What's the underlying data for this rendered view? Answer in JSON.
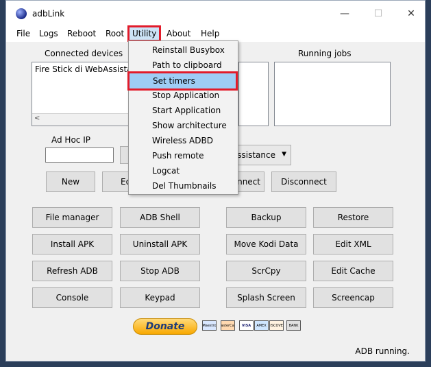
{
  "window": {
    "title": "adbLink",
    "min": "—",
    "max": "☐",
    "close": "✕"
  },
  "menu": [
    "File",
    "Logs",
    "Reboot",
    "Root",
    "Utility",
    "About",
    "Help"
  ],
  "labels": {
    "connected_devices": "Connected devices",
    "running_jobs": "Running jobs",
    "adhoc_ip": "Ad Hoc IP"
  },
  "devices": [
    "Fire Stick di WebAssistance"
  ],
  "device_select": "WebAssistance",
  "scroll_left": "<",
  "buttons": {
    "new": "New",
    "edit": "Edit",
    "connect": "Connect",
    "disconnect": "Disconnect",
    "file_manager": "File manager",
    "adb_shell": "ADB Shell",
    "backup": "Backup",
    "restore": "Restore",
    "install_apk": "Install APK",
    "uninstall_apk": "Uninstall APK",
    "move_kodi": "Move Kodi Data",
    "edit_xml": "Edit XML",
    "refresh_adb": "Refresh ADB",
    "stop_adb": "Stop ADB",
    "scrcpy": "ScrCpy",
    "edit_cache": "Edit Cache",
    "console": "Console",
    "keypad": "Keypad",
    "splash": "Splash Screen",
    "screencap": "Screencap"
  },
  "donate": "Donate",
  "cards": [
    "Maestro",
    "MasterCard",
    "VISA",
    "AMEX",
    "DISCOVER",
    "BANK"
  ],
  "status": "ADB running.",
  "utility_menu": [
    "Reinstall Busybox",
    "Path to clipboard",
    "Set timers",
    "Stop Application",
    "Start Application",
    "Show architecture",
    "Wireless ADBD",
    "Push remote",
    "Logcat",
    "Del Thumbnails"
  ]
}
